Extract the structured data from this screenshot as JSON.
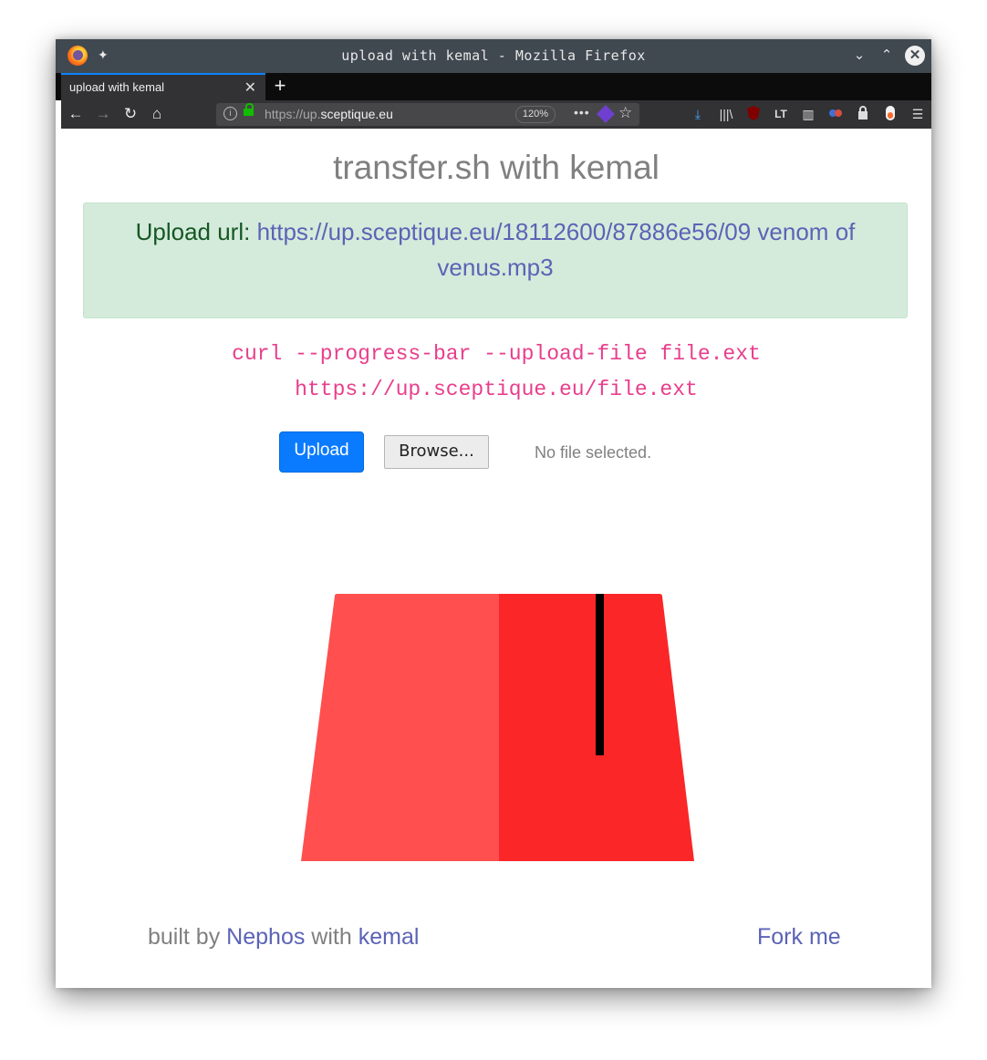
{
  "window": {
    "title": "upload with kemal - Mozilla Firefox"
  },
  "tab": {
    "label": "upload with kemal",
    "close_glyph": "✕",
    "new_tab_glyph": "+"
  },
  "navbar": {
    "url_prefix": "https://up.",
    "url_domain": "sceptique.eu",
    "zoom": "120%",
    "page_actions": "•••"
  },
  "page": {
    "heading": "transfer.sh with kemal",
    "alert": {
      "label": "Upload url:",
      "link": "https://up.sceptique.eu/18112600/87886e56/09 venom of venus.mp3"
    },
    "curl_line1": "curl --progress-bar --upload-file file.ext",
    "curl_line2": "https://up.sceptique.eu/file.ext",
    "upload_button": "Upload",
    "browse_button": "Browse...",
    "file_status": "No file selected.",
    "footer": {
      "built_by": "built by",
      "author": "Nephos",
      "with": "with",
      "framework": "kemal",
      "fork": "Fork me"
    }
  },
  "colors": {
    "accent": "#0a7bff",
    "link": "#5b63b6",
    "alert_bg": "#d4ebdb",
    "code": "#e83e8c",
    "fez_light": "#ff4f4f",
    "fez_dark": "#fa2627"
  },
  "icons": [
    "firefox-logo-icon",
    "pin-icon",
    "chevron-down-icon",
    "chevron-up-icon",
    "close-icon",
    "back-icon",
    "forward-icon",
    "reload-icon",
    "home-icon",
    "info-icon",
    "lock-icon",
    "extension-icon",
    "bookmark-star-icon",
    "download-icon",
    "library-icon",
    "ublock-icon",
    "languagetool-icon",
    "sidebar-icon",
    "extension2-icon",
    "lock-addon-icon",
    "addon-icon",
    "menu-icon"
  ]
}
